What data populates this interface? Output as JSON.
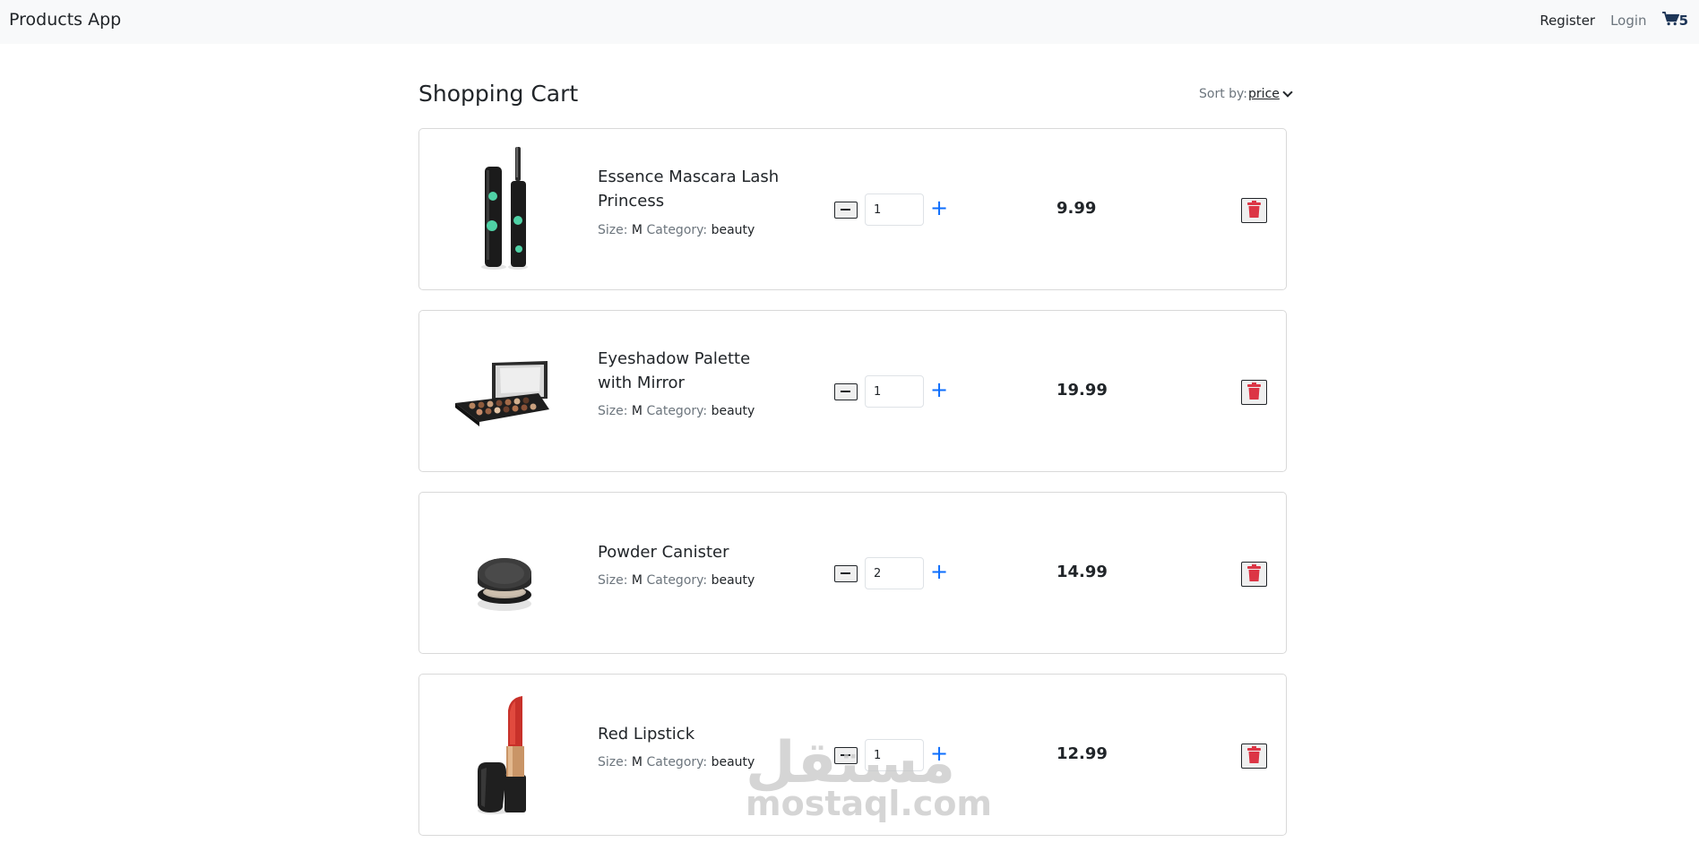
{
  "app": {
    "brand": "Products App"
  },
  "nav": {
    "register": "Register",
    "login": "Login",
    "cart_count": "5",
    "cart_icon": "shopping-cart-icon"
  },
  "header": {
    "title": "Shopping Cart",
    "sort_label": "Sort by:",
    "sort_value": "price"
  },
  "items": [
    {
      "name": "Essence Mascara Lash Princess",
      "size_label": "Size:",
      "size": "M",
      "category_label": "Category:",
      "category": "beauty",
      "quantity": "1",
      "price": "9.99",
      "image": "mascara"
    },
    {
      "name": "Eyeshadow Palette with Mirror",
      "size_label": "Size:",
      "size": "M",
      "category_label": "Category:",
      "category": "beauty",
      "quantity": "1",
      "price": "19.99",
      "image": "eyeshadow-palette"
    },
    {
      "name": "Powder Canister",
      "size_label": "Size:",
      "size": "M",
      "category_label": "Category:",
      "category": "beauty",
      "quantity": "2",
      "price": "14.99",
      "image": "powder-canister"
    },
    {
      "name": "Red Lipstick",
      "size_label": "Size:",
      "size": "M",
      "category_label": "Category:",
      "category": "beauty",
      "quantity": "1",
      "price": "12.99",
      "image": "lipstick"
    }
  ],
  "controls": {
    "increment": "+",
    "decrement_icon": "minus-icon",
    "delete_icon": "trash-icon",
    "delete_color": "#dc3545",
    "accent": "#0d6efd"
  },
  "watermark": {
    "arabic": "مستقل",
    "latin": "mostaql.com"
  }
}
